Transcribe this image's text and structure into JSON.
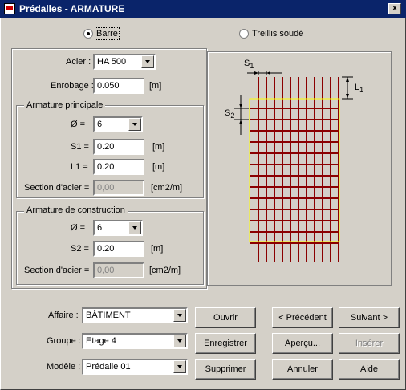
{
  "window": {
    "title": "Prédalles - ARMATURE",
    "close": "x"
  },
  "type": {
    "options": [
      "Barre",
      "Treillis soudé"
    ],
    "selected": "Barre"
  },
  "acier": {
    "label": "Acier :",
    "value": "HA 500"
  },
  "enrobage": {
    "label": "Enrobage :",
    "value": "0.050",
    "unit": "[m]"
  },
  "principale": {
    "title": "Armature principale",
    "diam_label": "Ø =",
    "diam_value": "6",
    "s1_label": "S1 =",
    "s1_value": "0.20",
    "s1_unit": "[m]",
    "l1_label": "L1 =",
    "l1_value": "0.20",
    "l1_unit": "[m]",
    "section_label": "Section d'acier =",
    "section_value": "0,00",
    "section_unit": "[cm2/m]"
  },
  "construction": {
    "title": "Armature de construction",
    "diam_label": "Ø =",
    "diam_value": "6",
    "s2_label": "S2 =",
    "s2_value": "0.20",
    "s2_unit": "[m]",
    "section_label": "Section d'acier =",
    "section_value": "0,00",
    "section_unit": "[cm2/m]"
  },
  "diagram": {
    "s1": "S",
    "s1_sub": "1",
    "s2": "S",
    "s2_sub": "2",
    "l1": "L",
    "l1_sub": "1",
    "bar_color": "#8b0000",
    "outline_color": "#ffff00"
  },
  "bottom": {
    "affaire_label": "Affaire :",
    "affaire_value": "BÂTIMENT",
    "groupe_label": "Groupe :",
    "groupe_value": "Etage 4",
    "modele_label": "Modèle :",
    "modele_value": "Prédalle 01"
  },
  "buttons": {
    "ouvrir": "Ouvrir",
    "enregistrer": "Enregistrer",
    "supprimer": "Supprimer",
    "precedent": "< Précédent",
    "suivant": "Suivant >",
    "apercu": "Aperçu...",
    "inserer": "Insérer",
    "annuler": "Annuler",
    "aide": "Aide"
  }
}
